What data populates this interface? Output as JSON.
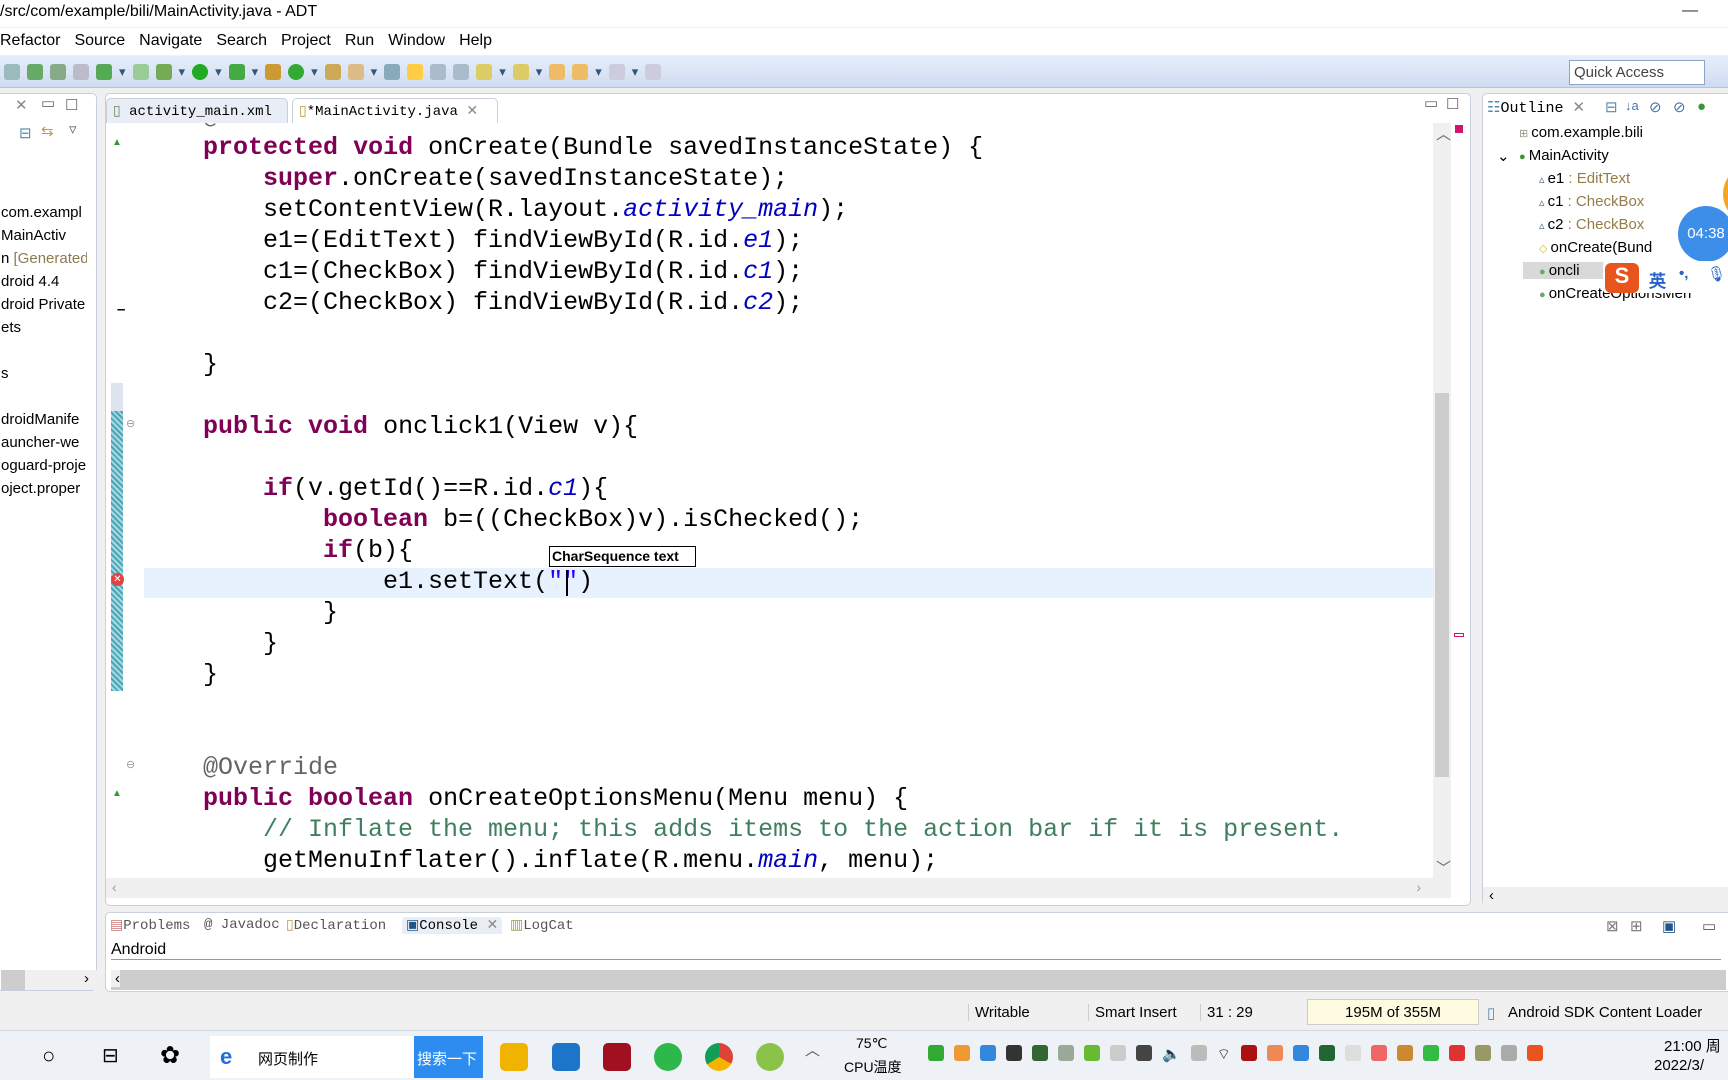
{
  "window": {
    "title": "/src/com/example/bili/MainActivity.java - ADT",
    "controls": "—"
  },
  "menu": [
    "Refactor",
    "Source",
    "Navigate",
    "Search",
    "Project",
    "Run",
    "Window",
    "Help"
  ],
  "toolbar": {
    "quick_access": "Quick Access"
  },
  "left_panel": {
    "items": [
      {
        "label": "com.exampl",
        "extra": ""
      },
      {
        "label": "MainActiv",
        "extra": ""
      },
      {
        "label": "n ",
        "extra": "[Generated"
      },
      {
        "label": "droid 4.4",
        "extra": ""
      },
      {
        "label": "droid Private",
        "extra": ""
      },
      {
        "label": "ets",
        "extra": ""
      },
      {
        "label": "",
        "extra": ""
      },
      {
        "label": "s",
        "extra": ""
      },
      {
        "label": "",
        "extra": ""
      },
      {
        "label": "droidManife",
        "extra": ""
      },
      {
        "label": "auncher-we",
        "extra": ""
      },
      {
        "label": "oguard-proje",
        "extra": ""
      },
      {
        "label": "oject.proper",
        "extra": ""
      }
    ]
  },
  "editor": {
    "tabs": [
      {
        "label": "activity_main.xml",
        "icon": "xml-file-icon"
      },
      {
        "label": "*MainActivity.java",
        "icon": "java-file-icon",
        "active": true
      }
    ],
    "tooltip": "CharSequence text",
    "lines": [
      [
        [
          "    @Override",
          "an"
        ]
      ],
      [
        [
          "    "
        ],
        [
          "protected",
          "kw"
        ],
        [
          " "
        ],
        [
          "void",
          "kw"
        ],
        [
          " onCreate(Bundle savedInstanceState) {"
        ]
      ],
      [
        [
          "        "
        ],
        [
          "super",
          "kw"
        ],
        [
          ".onCreate(savedInstanceState);"
        ]
      ],
      [
        [
          "        setContentView(R.layout."
        ],
        [
          "activity_main",
          "fld"
        ],
        [
          ");"
        ]
      ],
      [
        [
          "        e1=(EditText) findViewById(R.id."
        ],
        [
          "e1",
          "fld"
        ],
        [
          ");"
        ]
      ],
      [
        [
          "        c1=(CheckBox) findViewById(R.id."
        ],
        [
          "c1",
          "fld"
        ],
        [
          ");"
        ]
      ],
      [
        [
          "        c2=(CheckBox) findViewById(R.id."
        ],
        [
          "c2",
          "fld"
        ],
        [
          ");"
        ]
      ],
      [
        [
          ""
        ]
      ],
      [
        [
          "    }"
        ]
      ],
      [
        [
          ""
        ]
      ],
      [
        [
          "    "
        ],
        [
          "public",
          "kw"
        ],
        [
          " "
        ],
        [
          "void",
          "kw"
        ],
        [
          " onclick1(View v){"
        ]
      ],
      [
        [
          ""
        ]
      ],
      [
        [
          "        "
        ],
        [
          "if",
          "kw"
        ],
        [
          "(v.getId()==R.id."
        ],
        [
          "c1",
          "fld"
        ],
        [
          "){"
        ]
      ],
      [
        [
          "            "
        ],
        [
          "boolean",
          "kw"
        ],
        [
          " b=((CheckBox)v).isChecked();"
        ]
      ],
      [
        [
          "            "
        ],
        [
          "if",
          "kw"
        ],
        [
          "(b){"
        ]
      ],
      [
        [
          "                e1.setText("
        ],
        [
          "\"\"",
          "str"
        ],
        [
          ")"
        ]
      ],
      [
        [
          "            }"
        ]
      ],
      [
        [
          "        }"
        ]
      ],
      [
        [
          "    }"
        ]
      ],
      [
        [
          ""
        ]
      ],
      [
        [
          ""
        ]
      ],
      [
        [
          "    @Override",
          "an"
        ]
      ],
      [
        [
          "    "
        ],
        [
          "public",
          "kw"
        ],
        [
          " "
        ],
        [
          "boolean",
          "kw"
        ],
        [
          " onCreateOptionsMenu(Menu menu) {"
        ]
      ],
      [
        [
          "        // Inflate the menu; this adds items to the action bar if it is present.",
          "cm"
        ]
      ],
      [
        [
          "        getMenuInflater().inflate(R.menu."
        ],
        [
          "main",
          "fld"
        ],
        [
          ", menu);"
        ]
      ]
    ]
  },
  "outline": {
    "title": "Outline",
    "items": [
      {
        "name": "com.example.bili",
        "type": ""
      },
      {
        "name": "MainActivity",
        "type": ""
      },
      {
        "name": "e1",
        "type": " : EditText"
      },
      {
        "name": "c1",
        "type": " : CheckBox"
      },
      {
        "name": "c2",
        "type": " : CheckBox"
      },
      {
        "name": "onCreate(Bund",
        "type": ""
      },
      {
        "name": "oncli",
        "type": ""
      },
      {
        "name": "onCreateOptionsMen",
        "type": ""
      }
    ]
  },
  "overlay": {
    "timer": "04:38",
    "ime": "英"
  },
  "bottom": {
    "tabs": [
      "Problems",
      "@ Javadoc",
      "Declaration",
      "Console",
      "LogCat"
    ],
    "console_name": "Android"
  },
  "status": {
    "mode": "Writable",
    "insert": "Smart Insert",
    "position": "31 : 29",
    "memory": "195M of 355M",
    "task": "Android SDK Content Loader"
  },
  "taskbar": {
    "search_text": "网页制作",
    "search_button": "搜索一下",
    "temp": "75℃",
    "temp_label": "CPU温度",
    "time": "21:00 周",
    "date": "2022/3/"
  }
}
